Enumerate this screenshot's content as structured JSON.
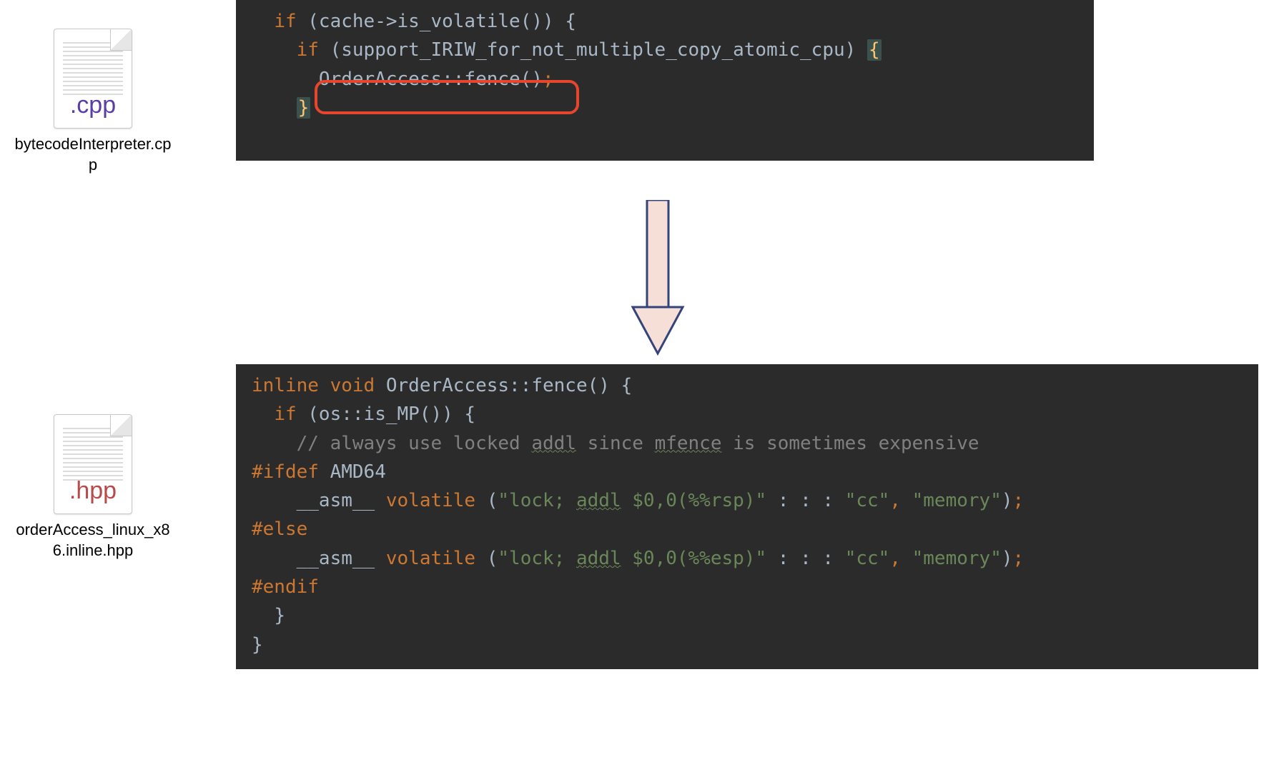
{
  "files": {
    "top": {
      "ext": ".cpp",
      "name": "bytecodeInterpreter.cpp"
    },
    "bottom": {
      "ext": ".hpp",
      "name": "orderAccess_linux_x86.inline.hpp"
    }
  },
  "code_top": {
    "l1_if": "if",
    "l1_rest": " (cache->is_volatile()) {",
    "l2_if": "if",
    "l2_rest": " (support_IRIW_for_not_multiple_copy_atomic_cpu) ",
    "l2_brace": "{",
    "l3_call": "OrderAccess::fence()",
    "l3_semi": ";",
    "l4_brace": "}"
  },
  "code_bottom": {
    "l1_inline": "inline",
    "l1_void": "void",
    "l1_sig": " OrderAccess::fence() {",
    "l2_if": "if",
    "l2_rest": " (os::is_MP()) {",
    "l3_comment_a": "// always use locked ",
    "l3_addl": "addl",
    "l3_comment_b": " since ",
    "l3_mfence": "mfence",
    "l3_comment_c": " is sometimes expensive",
    "l4_ifdef": "#ifdef",
    "l4_id": " AMD64",
    "l5_asm": "__asm__",
    "l5_vol": "volatile",
    "l5_str1": "\"lock; ",
    "l5_addl": "addl",
    "l5_str1b": " $0,0(%%rsp)\"",
    "l5_mid": " : : : ",
    "l5_cc": "\"cc\"",
    "l5_comma": ", ",
    "l5_mem": "\"memory\"",
    "l5_end": ")",
    "l5_semi": ";",
    "l6_else": "#else",
    "l7_str1": "\"lock; ",
    "l7_addl": "addl",
    "l7_str1b": " $0,0(%%esp)\"",
    "l8_endif": "#endif",
    "l9_brace": "}",
    "l10_brace": "}"
  }
}
